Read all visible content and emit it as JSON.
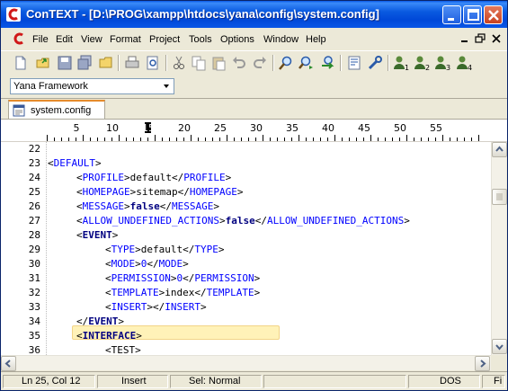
{
  "window": {
    "title": "ConTEXT - [D:\\PROG\\xampp\\htdocs\\yana\\config\\system.config]",
    "minimize_label": "minimize-icon",
    "maximize_label": "maximize-icon",
    "close_label": "close-icon"
  },
  "menu": {
    "items": [
      "File",
      "Edit",
      "View",
      "Format",
      "Project",
      "Tools",
      "Options",
      "Window",
      "Help"
    ]
  },
  "toolbar": {
    "icons": [
      "new-file-icon",
      "open-file-icon",
      "save-icon",
      "save-all-icon",
      "open-folder-icon",
      "print-icon",
      "print-preview-icon",
      "cut-icon",
      "copy-icon",
      "paste-icon",
      "undo-icon",
      "redo-icon",
      "find-icon",
      "find-next-icon",
      "replace-icon",
      "word-wrap-icon",
      "tools-icon",
      "user-command-1-icon",
      "user-command-2-icon",
      "user-command-3-icon",
      "user-command-4-icon"
    ]
  },
  "highlighter": {
    "value": "Yana Framework"
  },
  "tabs": [
    {
      "label": "system.config",
      "active": true
    }
  ],
  "ruler": {
    "labels": [
      "5",
      "10",
      "15",
      "20",
      "25",
      "30",
      "35",
      "40",
      "45",
      "50",
      "55"
    ]
  },
  "editor": {
    "lines": [
      {
        "n": "22",
        "indent": 0,
        "parts": []
      },
      {
        "n": "23",
        "indent": 0,
        "parts": [
          [
            "brk",
            "<"
          ],
          [
            "tag",
            "DEFAULT"
          ],
          [
            "brk",
            ">"
          ]
        ]
      },
      {
        "n": "24",
        "indent": 1,
        "parts": [
          [
            "brk",
            "<"
          ],
          [
            "tag",
            "PROFILE"
          ],
          [
            "brk",
            ">"
          ],
          [
            "txt",
            "default"
          ],
          [
            "brk",
            "</"
          ],
          [
            "tag",
            "PROFILE"
          ],
          [
            "brk",
            ">"
          ]
        ]
      },
      {
        "n": "25",
        "indent": 1,
        "parts": [
          [
            "brk",
            "<"
          ],
          [
            "tag",
            "HOMEPAGE"
          ],
          [
            "brk",
            ">"
          ],
          [
            "txt",
            "sitemap"
          ],
          [
            "brk",
            "</"
          ],
          [
            "tag",
            "HOMEPAGE"
          ],
          [
            "brk",
            ">"
          ]
        ]
      },
      {
        "n": "26",
        "indent": 1,
        "parts": [
          [
            "brk",
            "<"
          ],
          [
            "tag",
            "MESSAGE"
          ],
          [
            "brk",
            ">"
          ],
          [
            "kw",
            "false"
          ],
          [
            "brk",
            "</"
          ],
          [
            "tag",
            "MESSAGE"
          ],
          [
            "brk",
            ">"
          ]
        ]
      },
      {
        "n": "27",
        "indent": 1,
        "parts": [
          [
            "brk",
            "<"
          ],
          [
            "tag",
            "ALLOW_UNDEFINED_ACTIONS"
          ],
          [
            "brk",
            ">"
          ],
          [
            "kw",
            "false"
          ],
          [
            "brk",
            "</"
          ],
          [
            "tag",
            "ALLOW_UNDEFINED_ACTIONS"
          ],
          [
            "brk",
            ">"
          ]
        ]
      },
      {
        "n": "28",
        "indent": 1,
        "parts": [
          [
            "brk",
            "<"
          ],
          [
            "kw",
            "EVENT"
          ],
          [
            "brk",
            ">"
          ]
        ]
      },
      {
        "n": "29",
        "indent": 2,
        "parts": [
          [
            "brk",
            "<"
          ],
          [
            "tag",
            "TYPE"
          ],
          [
            "brk",
            ">"
          ],
          [
            "txt",
            "default"
          ],
          [
            "brk",
            "</"
          ],
          [
            "tag",
            "TYPE"
          ],
          [
            "brk",
            ">"
          ]
        ]
      },
      {
        "n": "30",
        "indent": 2,
        "parts": [
          [
            "brk",
            "<"
          ],
          [
            "tag",
            "MODE"
          ],
          [
            "brk",
            ">"
          ],
          [
            "tag",
            "0"
          ],
          [
            "brk",
            "</"
          ],
          [
            "tag",
            "MODE"
          ],
          [
            "brk",
            ">"
          ]
        ]
      },
      {
        "n": "31",
        "indent": 2,
        "parts": [
          [
            "brk",
            "<"
          ],
          [
            "tag",
            "PERMISSION"
          ],
          [
            "brk",
            ">"
          ],
          [
            "tag",
            "0"
          ],
          [
            "brk",
            "</"
          ],
          [
            "tag",
            "PERMISSION"
          ],
          [
            "brk",
            ">"
          ]
        ]
      },
      {
        "n": "32",
        "indent": 2,
        "parts": [
          [
            "brk",
            "<"
          ],
          [
            "tag",
            "TEMPLATE"
          ],
          [
            "brk",
            ">"
          ],
          [
            "txt",
            "index"
          ],
          [
            "brk",
            "</"
          ],
          [
            "tag",
            "TEMPLATE"
          ],
          [
            "brk",
            ">"
          ]
        ]
      },
      {
        "n": "33",
        "indent": 2,
        "parts": [
          [
            "brk",
            "<"
          ],
          [
            "tag",
            "INSERT"
          ],
          [
            "brk",
            "></"
          ],
          [
            "tag",
            "INSERT"
          ],
          [
            "brk",
            ">"
          ]
        ]
      },
      {
        "n": "34",
        "indent": 1,
        "parts": [
          [
            "brk",
            "</"
          ],
          [
            "kw",
            "EVENT"
          ],
          [
            "brk",
            ">"
          ]
        ]
      },
      {
        "n": "35",
        "indent": 1,
        "parts": [
          [
            "brk",
            "<"
          ],
          [
            "kw",
            "INTERFACE"
          ],
          [
            "brk",
            ">"
          ]
        ]
      },
      {
        "n": "36",
        "indent": 2,
        "parts": [
          [
            "brk",
            "<"
          ],
          [
            "txt",
            "TEST"
          ],
          [
            "brk",
            ">"
          ]
        ]
      }
    ]
  },
  "status": {
    "position": "Ln 25, Col 12",
    "mode": "Insert",
    "selection": "Sel: Normal",
    "blank": "",
    "format": "DOS",
    "file": "Fi"
  }
}
